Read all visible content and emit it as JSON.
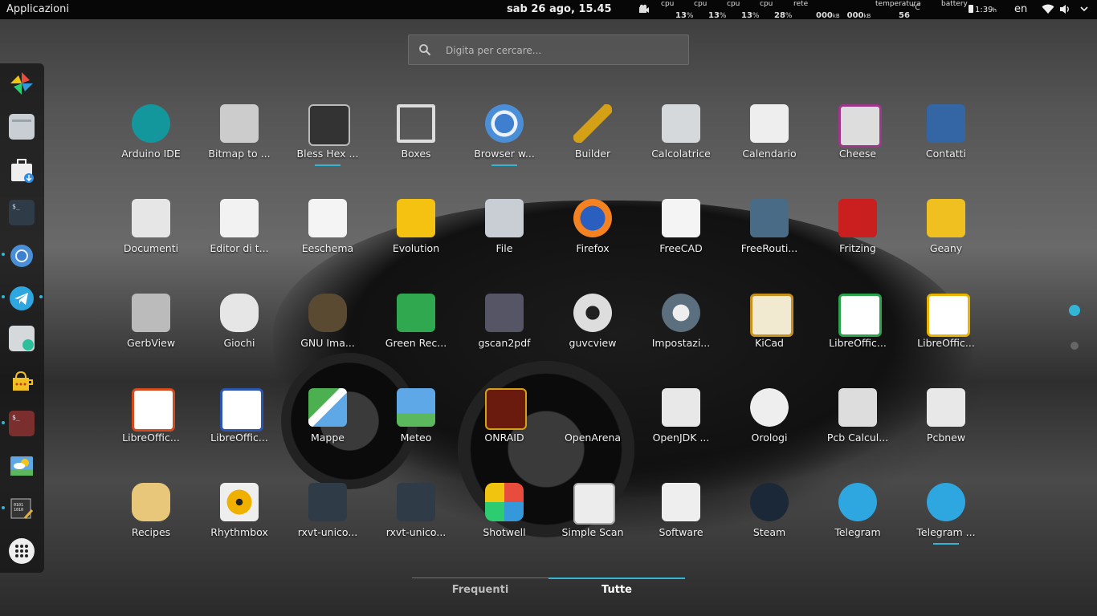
{
  "topbar": {
    "apps_label": "Applicazioni",
    "clock": "sab 26 ago, 15.45",
    "cpu_label": "cpu",
    "cpu1": "13",
    "cpu2": "13",
    "cpu3": "13",
    "cpu4": "28",
    "cpu_unit": "%",
    "net_label": "rete",
    "net_down": "000",
    "net_up": "000",
    "net_unit": "kB",
    "temp_label": "temperatura",
    "temp_value": "56",
    "temp_unit": "°C",
    "battery_label": "battery",
    "battery_time": "1:39",
    "battery_unit": "h",
    "lang": "en"
  },
  "search": {
    "placeholder": "Digita per cercare..."
  },
  "dock": {
    "items": [
      "shotwell",
      "files",
      "software",
      "terminal",
      "chromium",
      "telegram",
      "calculator",
      "geany",
      "terminal-red",
      "weather",
      "bless-hex",
      "show-apps"
    ]
  },
  "apps": [
    {
      "label": "Arduino IDE",
      "icon": "arduino-icon"
    },
    {
      "label": "Bitmap to ...",
      "icon": "bitmap-icon"
    },
    {
      "label": "Bless Hex ...",
      "icon": "hex-editor-icon"
    },
    {
      "label": "Boxes",
      "icon": "boxes-icon"
    },
    {
      "label": "Browser w...",
      "icon": "chromium-icon"
    },
    {
      "label": "Builder",
      "icon": "builder-icon"
    },
    {
      "label": "Calcolatrice",
      "icon": "calculator-icon"
    },
    {
      "label": "Calendario",
      "icon": "calendar-icon"
    },
    {
      "label": "Cheese",
      "icon": "cheese-icon"
    },
    {
      "label": "Contatti",
      "icon": "contacts-icon"
    },
    {
      "label": "Documenti",
      "icon": "documents-icon"
    },
    {
      "label": "Editor di t...",
      "icon": "text-editor-icon"
    },
    {
      "label": "Eeschema",
      "icon": "eeschema-icon"
    },
    {
      "label": "Evolution",
      "icon": "evolution-icon"
    },
    {
      "label": "File",
      "icon": "files-icon"
    },
    {
      "label": "Firefox",
      "icon": "firefox-icon"
    },
    {
      "label": "FreeCAD",
      "icon": "freecad-icon"
    },
    {
      "label": "FreeRouti...",
      "icon": "freerouting-icon"
    },
    {
      "label": "Fritzing",
      "icon": "fritzing-icon"
    },
    {
      "label": "Geany",
      "icon": "geany-icon"
    },
    {
      "label": "GerbView",
      "icon": "gerbview-icon"
    },
    {
      "label": "Giochi",
      "icon": "games-icon"
    },
    {
      "label": "GNU Ima...",
      "icon": "gimp-icon"
    },
    {
      "label": "Green Rec...",
      "icon": "recorder-icon"
    },
    {
      "label": "gscan2pdf",
      "icon": "gscan2pdf-icon"
    },
    {
      "label": "guvcview",
      "icon": "webcam-icon"
    },
    {
      "label": "Impostazi...",
      "icon": "settings-icon"
    },
    {
      "label": "KiCad",
      "icon": "kicad-icon"
    },
    {
      "label": "LibreOffic...",
      "icon": "calc-icon"
    },
    {
      "label": "LibreOffic...",
      "icon": "draw-icon"
    },
    {
      "label": "LibreOffic...",
      "icon": "impress-icon"
    },
    {
      "label": "LibreOffic...",
      "icon": "writer-icon"
    },
    {
      "label": "Mappe",
      "icon": "maps-icon"
    },
    {
      "label": "Meteo",
      "icon": "weather-icon"
    },
    {
      "label": "ONRAID",
      "icon": "onraid-icon"
    },
    {
      "label": "OpenArena",
      "icon": "openarena-icon"
    },
    {
      "label": "OpenJDK ...",
      "icon": "java-icon"
    },
    {
      "label": "Orologi",
      "icon": "clocks-icon"
    },
    {
      "label": "Pcb Calcul...",
      "icon": "pcb-calculator-icon"
    },
    {
      "label": "Pcbnew",
      "icon": "pcbnew-icon"
    },
    {
      "label": "Recipes",
      "icon": "recipes-icon"
    },
    {
      "label": "Rhythmbox",
      "icon": "rhythmbox-icon"
    },
    {
      "label": "rxvt-unico...",
      "icon": "terminal-icon"
    },
    {
      "label": "rxvt-unico...",
      "icon": "terminal-icon"
    },
    {
      "label": "Shotwell",
      "icon": "shotwell-icon"
    },
    {
      "label": "Simple Scan",
      "icon": "scanner-icon"
    },
    {
      "label": "Software",
      "icon": "software-icon"
    },
    {
      "label": "Steam",
      "icon": "steam-icon"
    },
    {
      "label": "Telegram",
      "icon": "telegram-icon"
    },
    {
      "label": "Telegram ...",
      "icon": "telegram-icon"
    }
  ],
  "tabs": {
    "frequent": "Frequenti",
    "all": "Tutte"
  },
  "colors": {
    "accent": "#33b5d6",
    "topbar": "#000000"
  }
}
